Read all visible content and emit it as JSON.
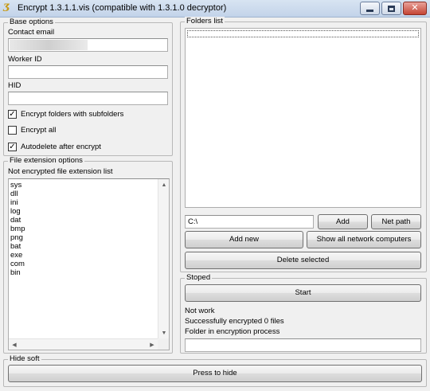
{
  "window": {
    "title": "Encrypt 1.3.1.1.vis (compatible with 1.3.1.0 decryptor)",
    "app_icon_glyph": "Ʒ",
    "controls": {
      "minimize": "minimize-icon",
      "maximize": "maximize-icon",
      "close": "✕"
    }
  },
  "base_options": {
    "title": "Base options",
    "contact_email_label": "Contact email",
    "contact_email_value": "",
    "worker_id_label": "Worker ID",
    "worker_id_value": "",
    "hid_label": "HID",
    "hid_value": "",
    "checkboxes": [
      {
        "label": "Encrypt folders with subfolders",
        "checked": true
      },
      {
        "label": "Encrypt all",
        "checked": false
      },
      {
        "label": "Autodelete after encrypt",
        "checked": true
      }
    ]
  },
  "file_extension_options": {
    "title": "File extension options",
    "list_label": "Not encrypted file extension list",
    "extensions": [
      "sys",
      "dll",
      "ini",
      "log",
      "dat",
      "bmp",
      "png",
      "bat",
      "exe",
      "com",
      "bin"
    ]
  },
  "folders": {
    "title": "Folders list",
    "path_value": "C:\\",
    "add_button": "Add",
    "net_path_button": "Net path",
    "add_new_button": "Add new",
    "show_network_button": "Show all network computers",
    "delete_selected_button": "Delete selected"
  },
  "status": {
    "title": "Stoped",
    "start_button": "Start",
    "state_text": "Not work",
    "encrypted_text": "Successfully encrypted 0 files",
    "folder_label": "Folder in encryption process",
    "folder_value": ""
  },
  "hide_soft": {
    "title": "Hide soft",
    "button": "Press to hide"
  },
  "colors": {
    "titlebar": "#c2d3e9",
    "close_button": "#c44434",
    "window_bg": "#f0f0f0"
  }
}
